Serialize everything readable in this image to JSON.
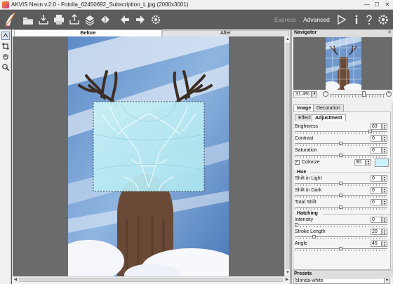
{
  "window": {
    "title": "AKVIS Neon v.2.0 - Fotolia_62450692_Subscription_L.jpg (2000x3001)",
    "minimize": "—",
    "maximize": "☐",
    "close": "✕"
  },
  "toolbar": {
    "icons": [
      "open-icon",
      "save-icon",
      "print-icon",
      "share-icon",
      "batch-icon",
      "before-after-icon",
      "back-icon",
      "forward-icon",
      "settings-gear-icon"
    ],
    "modes": {
      "express": "Express",
      "advanced": "Advanced"
    },
    "right_icons": [
      "run-icon",
      "info-icon",
      "help-icon",
      "preferences-icon"
    ],
    "colors": {
      "bg": "#5c5c5c",
      "active": "#ffffff",
      "inactive": "#a9a9a9"
    }
  },
  "tools": [
    "hand-tool-icon",
    "crop-icon",
    "hand-icon",
    "zoom-icon"
  ],
  "view_tabs": {
    "before": "Before",
    "after": "After"
  },
  "navigator": {
    "title": "Navigator",
    "zoom": "31.4%"
  },
  "settings": {
    "main_tabs": {
      "image": "Image",
      "decoration": "Decoration"
    },
    "sub_tabs": {
      "effect": "Effect",
      "adjustment": "Adjustment"
    },
    "brightness": {
      "label": "Brightness",
      "value": "83",
      "level": 0.83
    },
    "contrast": {
      "label": "Contrast",
      "value": "0",
      "level": 0.5
    },
    "saturation": {
      "label": "Saturation",
      "value": "0",
      "level": 0.5
    },
    "colorize": {
      "label": "Colorize",
      "checked": "✓",
      "value": "90",
      "color": "#c9f2fb"
    },
    "hue_group": "Hue",
    "shift_light": {
      "label": "Shift in Light",
      "value": "0",
      "level": 0.5
    },
    "shift_dark": {
      "label": "Shift in Dark",
      "value": "0",
      "level": 0.5
    },
    "total_shift": {
      "label": "Total Shift",
      "value": "0",
      "level": 0.5
    },
    "hatching_group": "Hatching",
    "intensity": {
      "label": "Intensity",
      "value": "0",
      "level": 0.0
    },
    "stroke_length": {
      "label": "Stroke Length",
      "value": "20",
      "level": 0.2
    },
    "angle": {
      "label": "Angle",
      "value": "45",
      "level": 0.5
    }
  },
  "presets": {
    "title": "Presets",
    "selected": "blonda-white"
  }
}
